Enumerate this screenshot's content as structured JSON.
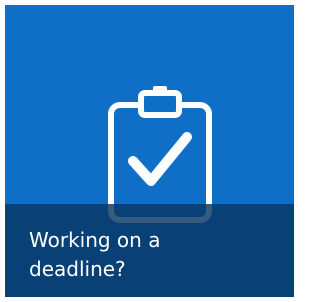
{
  "tile": {
    "caption": "Working on a deadline?",
    "icon": "clipboard-check-icon",
    "colors": {
      "background": "#0f6fc6",
      "caption_band": "#083764",
      "icon_stroke": "#ffffff"
    }
  }
}
